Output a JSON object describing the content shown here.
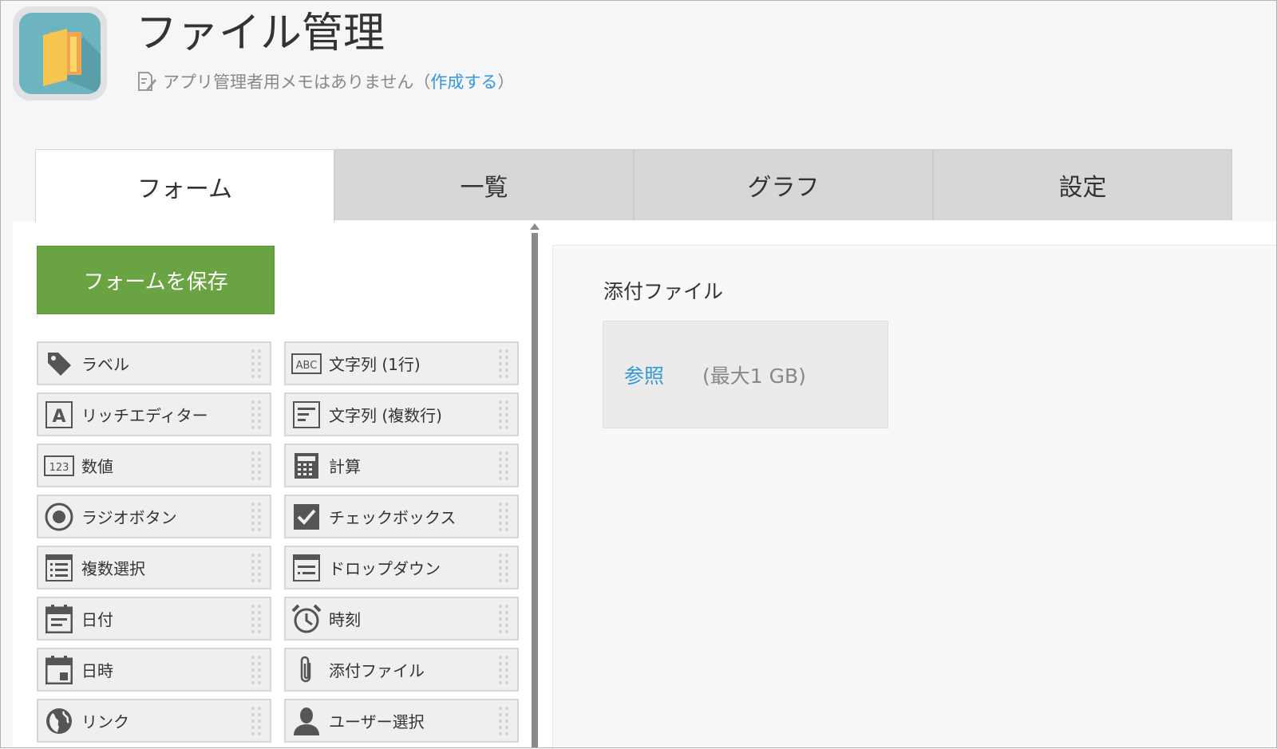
{
  "header": {
    "app_title": "ファイル管理",
    "memo_text": "アプリ管理者用メモはありません（",
    "memo_link": "作成する",
    "memo_close": "）",
    "app_icon_name": "folder-icon"
  },
  "tabs": [
    {
      "label": "フォーム",
      "active": true
    },
    {
      "label": "一覧",
      "active": false
    },
    {
      "label": "グラフ",
      "active": false
    },
    {
      "label": "設定",
      "active": false
    }
  ],
  "toolbar": {
    "save_label": "フォームを保存"
  },
  "palette": [
    {
      "label": "ラベル",
      "icon": "tag-icon"
    },
    {
      "label": "文字列 (1行)",
      "icon": "abc-text-icon"
    },
    {
      "label": "リッチエディター",
      "icon": "rich-editor-icon"
    },
    {
      "label": "文字列 (複数行)",
      "icon": "multiline-text-icon"
    },
    {
      "label": "数値",
      "icon": "number-icon"
    },
    {
      "label": "計算",
      "icon": "calculator-icon"
    },
    {
      "label": "ラジオボタン",
      "icon": "radio-icon"
    },
    {
      "label": "チェックボックス",
      "icon": "checkbox-icon"
    },
    {
      "label": "複数選択",
      "icon": "multi-select-icon"
    },
    {
      "label": "ドロップダウン",
      "icon": "dropdown-icon"
    },
    {
      "label": "日付",
      "icon": "calendar-icon"
    },
    {
      "label": "時刻",
      "icon": "alarm-clock-icon"
    },
    {
      "label": "日時",
      "icon": "calendar-datetime-icon"
    },
    {
      "label": "添付ファイル",
      "icon": "paperclip-icon"
    },
    {
      "label": "リンク",
      "icon": "globe-icon"
    },
    {
      "label": "ユーザー選択",
      "icon": "user-icon"
    }
  ],
  "canvas": {
    "field_title": "添付ファイル",
    "browse_label": "参照",
    "max_size": "(最大1 GB)"
  },
  "colors": {
    "save_button": "#6aa341",
    "link": "#3498db",
    "tab_inactive": "#d5d7d8",
    "app_icon_bg": "#6cb4c0"
  }
}
